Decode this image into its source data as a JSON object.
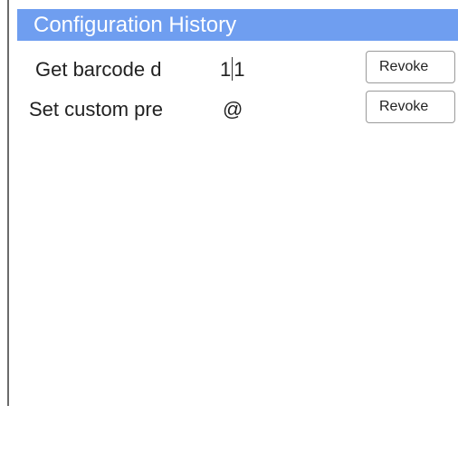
{
  "panel": {
    "title": "Configuration History"
  },
  "history": [
    {
      "label": "Get barcode d",
      "value_before_cursor": "1",
      "value_after_cursor": "1",
      "revoke_label": "Revoke"
    },
    {
      "label": "Set custom pre",
      "value": "@",
      "revoke_label": "Revoke"
    }
  ],
  "colors": {
    "header_background": "#6f9ef0",
    "header_text": "#ffffff",
    "button_border": "#9a9a9a"
  }
}
